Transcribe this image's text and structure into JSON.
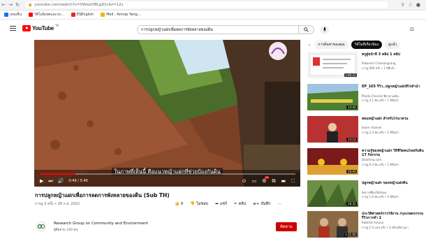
{
  "browser": {
    "url": "youtube.com/watch?v=0WwzOBLg91c&t=12s",
    "bookmarks": [
      {
        "label": "เคนเซ็น",
        "color": "#1a73e8"
      },
      {
        "label": "วิดีโอนิเทศและรถ...",
        "color": "#ff0000"
      },
      {
        "label": "ESEnglish",
        "color": "#d93025"
      },
      {
        "label": "Mail - Annop Yang...",
        "color": "#f4b400"
      }
    ]
  },
  "header": {
    "logo": "YouTube",
    "logo_sup": "TH",
    "search_value": "การปลูกหญ้าแฝกเพื่อลดการพังทลายของดิน"
  },
  "player": {
    "subtitle": "ในภาพที่เห็นนี้ คือแนวหญ้าแฝกที่ช่วยป้องกันดิน",
    "time": "0:49 / 5:49",
    "progress": 0.14
  },
  "video": {
    "title": "การปลูกหญ้าแฝกเพื่อการลดการพังทลายของดิน (Sub TH)",
    "meta": "การดู 2 ครั้ง • 26 ก.ย. 2022",
    "actions": [
      {
        "icon": "thumbs-up-icon",
        "label": "0"
      },
      {
        "icon": "thumbs-down-icon",
        "label": "ไม่ชอบ"
      },
      {
        "icon": "share-icon",
        "label": "แชร์"
      },
      {
        "icon": "clip-icon",
        "label": "คลิป"
      },
      {
        "icon": "save-icon",
        "label": "บันทึก"
      },
      {
        "icon": "more-icon",
        "label": "⋯"
      }
    ]
  },
  "channel": {
    "name": "Research Group on Community and Environment",
    "subs": "ผู้ติดตาม 100 คน",
    "subscribe_label": "ติดตาม"
  },
  "sidebar": {
    "chips": [
      "การค้นหาของคุณ",
      "วิดีโอที่เกี่ยวข้อง",
      "ดูแล้ว"
    ],
    "active_chip": 1,
    "recommendations": [
      {
        "title": "ครูสู่หน้าที่ 3 คลิป 1 คลิป",
        "channel": "Pakasorn Chaosongrang",
        "meta": "การดู 960 ครั้ง • 1 ปีที่แล้ว",
        "duration": "1:06:22",
        "thumb": "#f4f4f4"
      },
      {
        "title": "EP_165 รีวิว..ปลูกหญ้าแฝกที่ไร่ลำน้ำ",
        "channel": "Phada Channel พี่ดาพาเพลิน",
        "meta": "การดู 3.1 พัน ครั้ง • 1 ปีที่แล้ว",
        "duration": "14:44",
        "thumb": "#3d6b2e"
      },
      {
        "title": "สอนหญ้าแฝก สำหรับไร่นาสวน",
        "channel": "boom channel",
        "meta": "การดู 2.3 พัน ครั้ง • 2 ปีที่แล้ว",
        "duration": "14:14",
        "thumb": "#9b2a2a"
      },
      {
        "title": "ความรู้ของหญ้าแฝก วิถีชีวิตคนไทยกับดิน 17 กิจกรรม",
        "channel": "Dhamma.com",
        "meta": "การดู 9.3 พัน ครั้ง • 1 ปีที่แล้ว",
        "duration": "16:44",
        "thumb": "#c7a04a"
      },
      {
        "title": "ปลูกหญ้าแฝก ของหญ้าแฝกดิน",
        "channel": "จัดการที่ดินให้เกิดผล",
        "meta": "การดู 1.6 พัน ครั้ง • 1 ปีที่แล้ว",
        "duration": "16:32",
        "thumb": "#5a7a3a"
      },
      {
        "title": "ประวัติศาสตร์การใช้งาน กรุงเกษตรกรรม รีวิวการทำ 1",
        "channel": "Rattchit Amuna",
        "meta": "การดู 2.3 แสน ครั้ง • 3 เดือนที่ผ่านมา",
        "duration": "1:31:06",
        "thumb": "#6b4a2a"
      }
    ]
  }
}
